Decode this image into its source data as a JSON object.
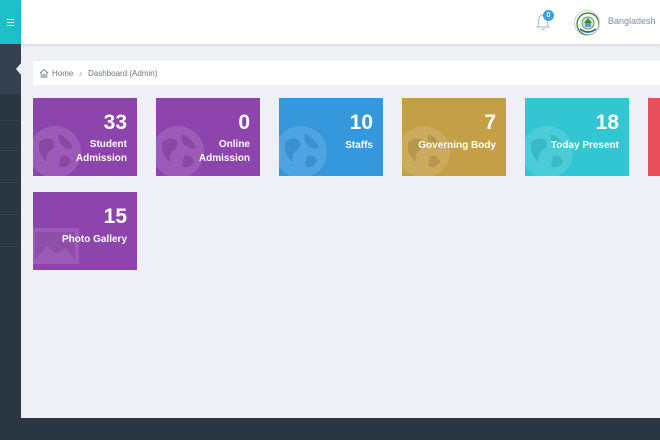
{
  "header": {
    "notification_count": "0",
    "user_name": "Bangladesh"
  },
  "breadcrumb": {
    "home": "Home",
    "current": "Dashboard (Admin)"
  },
  "tiles": [
    {
      "value": "33",
      "line1": "Student",
      "line2": "Admission",
      "color": "#8e44ad",
      "icon": "globe-icon"
    },
    {
      "value": "0",
      "line1": "Online",
      "line2": "Admission",
      "color": "#8e44ad",
      "icon": "globe-icon"
    },
    {
      "value": "10",
      "line1": "Staffs",
      "line2": "",
      "color": "#3598dc",
      "icon": "globe-icon"
    },
    {
      "value": "7",
      "line1": "Governing Body",
      "line2": "",
      "color": "#c49f47",
      "icon": "globe-icon"
    },
    {
      "value": "18",
      "line1": "Today Present",
      "line2": "",
      "color": "#32c5d2",
      "icon": "globe-icon"
    },
    {
      "value": "15",
      "line1": "Photo Gallery",
      "line2": "",
      "color": "#8e44ad",
      "icon": "gallery-icon"
    }
  ],
  "partial_tile_color": "#e7505a"
}
